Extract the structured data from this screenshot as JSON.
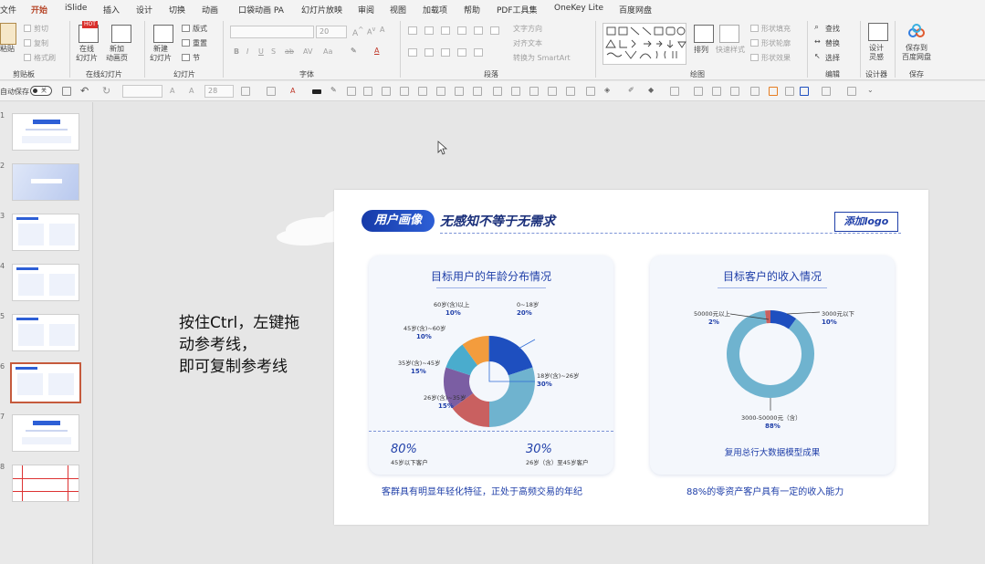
{
  "menubar": {
    "tabs": [
      "文件",
      "开始",
      "iSlide",
      "插入",
      "设计",
      "切换",
      "动画",
      "口袋动画 PA",
      "幻灯片放映",
      "审阅",
      "视图",
      "加载项",
      "帮助",
      "PDF工具集",
      "OneKey Lite",
      "百度网盘"
    ],
    "active": "开始"
  },
  "ribbon": {
    "clipboard": {
      "paste": "粘贴",
      "cut": "剪切",
      "copy": "复制",
      "format_painter": "格式刷",
      "label": "剪贴板"
    },
    "online_slides": {
      "online": "在线\n幻灯片",
      "new_anim": "新加\n动画页",
      "hot_badge": "HOT",
      "label": "在线幻灯片"
    },
    "slides": {
      "new_slide": "新建\n幻灯片",
      "layout": "版式",
      "reset": "重置",
      "section": "节",
      "label": "幻灯片"
    },
    "font": {
      "font_name": "",
      "font_size": "20",
      "label": "字体"
    },
    "paragraph": {
      "text_direction": "文字方向",
      "align_text": "对齐文本",
      "smartart": "转换为 SmartArt",
      "label": "段落"
    },
    "drawing": {
      "arrange": "排列",
      "quick_styles": "快速样式",
      "shape_fill": "形状填充",
      "shape_outline": "形状轮廓",
      "shape_effects": "形状效果",
      "label": "绘图"
    },
    "editing": {
      "find": "查找",
      "replace": "替换",
      "select": "选择",
      "label": "编辑"
    },
    "designer": {
      "design_ideas": "设计\n灵感",
      "label": "设计器"
    },
    "save": {
      "save_baidu": "保存到\n百度网盘",
      "label": "保存"
    }
  },
  "qat": {
    "autosave": "自动保存",
    "autosave_state": "关",
    "font_size": "28"
  },
  "thumbnails": [
    "1",
    "2",
    "3",
    "4",
    "5",
    "6",
    "7",
    "8"
  ],
  "selected_slide": "6",
  "annotation": {
    "line1": "按住Ctrl，左键拖",
    "line2": "动参考线，",
    "line3": "即可复制参考线"
  },
  "slide": {
    "tag": "用户画像",
    "headline": "无感知不等于无需求",
    "logo": "添加logo",
    "left_card": {
      "title": "目标用户的年龄分布情况",
      "stat1_value": "80%",
      "stat1_label": "45岁以下客户",
      "stat2_value": "30%",
      "stat2_label": "26岁（含）至45岁客户",
      "caption": "客群具有明显年轻化特征，正处于高频交易的年纪"
    },
    "right_card": {
      "title": "目标客户的收入情况",
      "note": "复用总行大数据模型成果",
      "caption": "88%的零资产客户具有一定的收入能力"
    }
  },
  "chart_data": [
    {
      "type": "pie",
      "title": "目标用户的年龄分布情况",
      "categories": [
        "0~18岁",
        "18岁(含)~26岁",
        "26岁(含)~35岁",
        "35岁(含)~45岁",
        "45岁(含)~60岁",
        "60岁(含)以上"
      ],
      "values": [
        20,
        30,
        15,
        15,
        10,
        10
      ],
      "labels": [
        "20%",
        "30%",
        "15%",
        "15%",
        "10%",
        "10%"
      ],
      "colors": [
        "#1e4fbf",
        "#6fb3cf",
        "#c96060",
        "#7b5ea3",
        "#4aaccd",
        "#f39c3d"
      ]
    },
    {
      "type": "pie",
      "title": "目标客户的收入情况",
      "categories": [
        "3000元以下",
        "3000-50000元（含）",
        "50000元以上"
      ],
      "values": [
        10,
        88,
        2
      ],
      "labels": [
        "10%",
        "88%",
        "2%"
      ],
      "colors": [
        "#1e4fbf",
        "#6fb3cf",
        "#c96060"
      ]
    }
  ]
}
